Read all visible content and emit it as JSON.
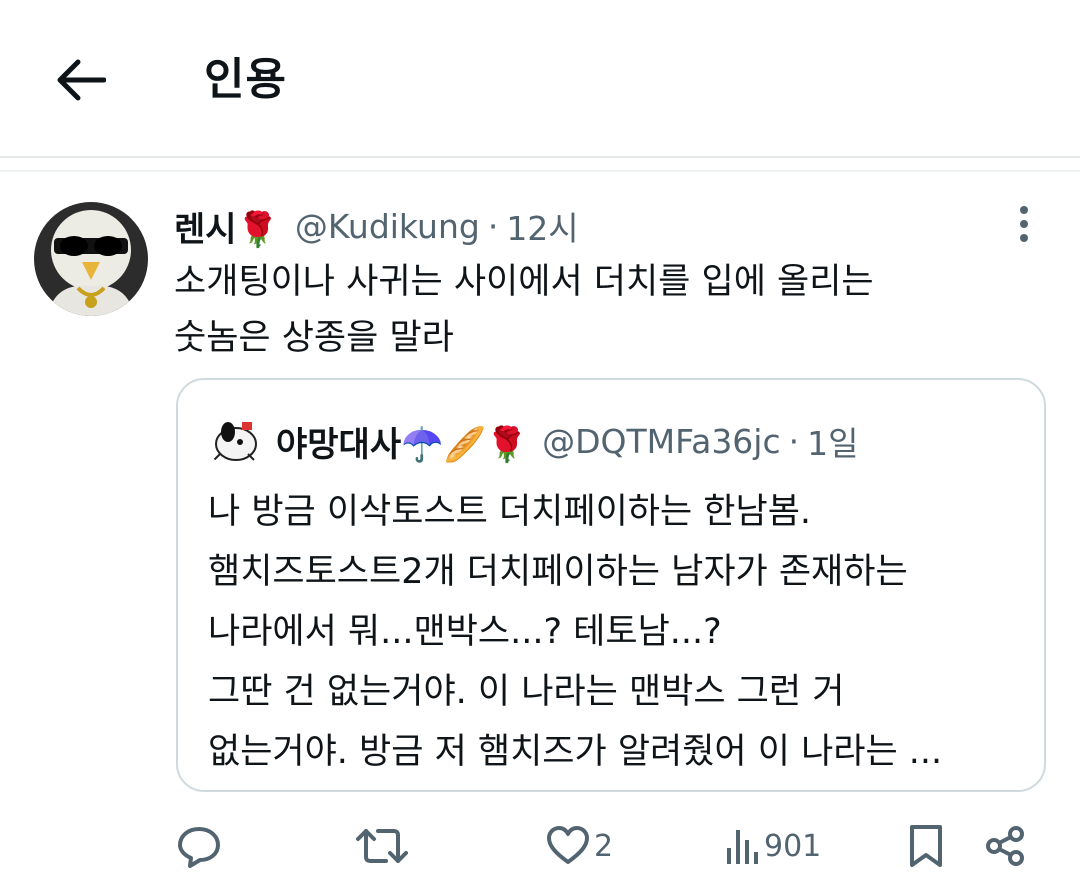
{
  "header": {
    "title": "인용",
    "back_icon": "arrow-left-icon"
  },
  "tweet": {
    "name": "렌시🌹",
    "handle": "@Kudikung",
    "separator": "·",
    "time": "12시",
    "text": "소개팅이나 사귀는 사이에서 더치를 입에 올리는\n숫놈은 상종을 말라",
    "more_icon": "more-vertical-icon"
  },
  "quoted": {
    "name": "야망대사☂️🥖🌹",
    "handle": "@DQTMFa36jc",
    "separator": "·",
    "time": "1일",
    "text": "나 방금 이삭토스트 더치페이하는 한남봄.\n햄치즈토스트2개 더치페이하는 남자가 존재하는\n나라에서 뭐...맨박스...? 테토남...?\n그딴 건 없는거야. 이 나라는 맨박스 그런 거\n없는거야. 방금 저 햄치즈가 알려줬어 이 나라는 ..."
  },
  "actions": {
    "reply_icon": "reply-icon",
    "retweet_icon": "retweet-icon",
    "like_icon": "heart-icon",
    "like_count": "2",
    "views_icon": "views-icon",
    "views_count": "901",
    "bookmark_icon": "bookmark-icon",
    "share_icon": "share-icon"
  },
  "colors": {
    "text": "#0f1419",
    "secondary": "#536471",
    "border": "#cfd9de"
  }
}
